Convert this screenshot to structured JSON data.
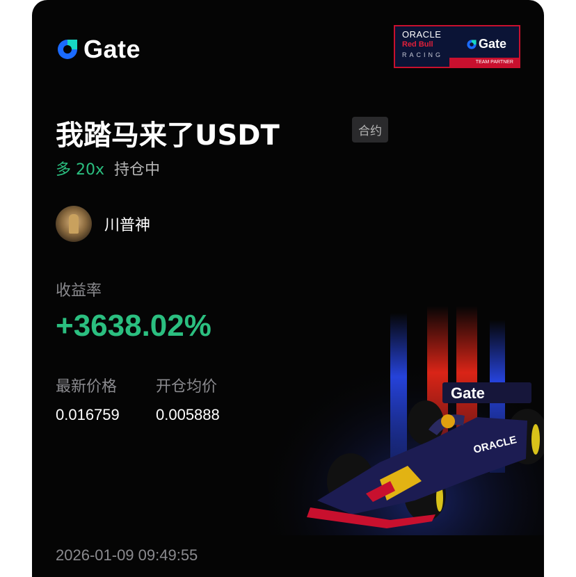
{
  "brand": {
    "name": "Gate",
    "accent_color": "#1b6bff"
  },
  "partner_banner": {
    "line1": "ORACLE",
    "line2": "Red Bull",
    "line3": "RACING",
    "gate": "Gate",
    "footer": "TEAM PARTNER"
  },
  "position": {
    "symbol": "我踏马来了USDT",
    "tag": "合约",
    "direction_leverage": "多 20x",
    "status": "持仓中"
  },
  "user": {
    "name": "川普神"
  },
  "roi": {
    "label": "收益率",
    "value": "+3638.02%",
    "color": "#2bbf80"
  },
  "prices": {
    "last_label": "最新价格",
    "last_value": "0.016759",
    "avg_label": "开仓均价",
    "avg_value": "0.005888"
  },
  "timestamp": "2026-01-09 09:49:55",
  "car_livery": {
    "text": "Gate",
    "side_text": "ORACLE"
  }
}
